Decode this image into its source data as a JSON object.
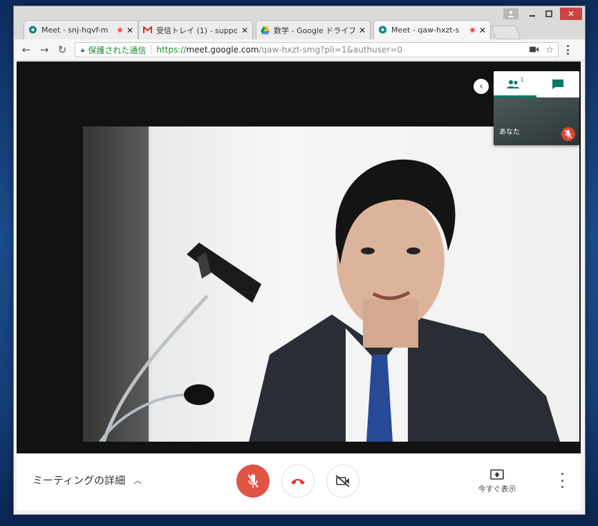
{
  "browser": {
    "tabs": [
      {
        "title": "Meet - snj-hqvf-m",
        "icon": "meet-icon",
        "recording": true,
        "active": false
      },
      {
        "title": "受信トレイ (1) - suppo",
        "icon": "gmail-icon",
        "recording": false,
        "active": false
      },
      {
        "title": "数学 - Google ドライブ",
        "icon": "drive-icon",
        "recording": false,
        "active": false
      },
      {
        "title": "Meet - qaw-hxzt-s",
        "icon": "meet-icon",
        "recording": true,
        "active": true
      }
    ],
    "address_bar": {
      "secure_label": "保護された通信",
      "scheme": "https://",
      "host": "meet.google.com",
      "path": "/qaw-hxzt-smg?pli=1&authuser=0"
    }
  },
  "meet": {
    "side_panel": {
      "people_count": "1",
      "self_label": "あなた"
    },
    "bottom_bar": {
      "meeting_details_label": "ミーティングの詳細",
      "present_now_label": "今すぐ表示"
    },
    "colors": {
      "mic_off": "#e05446",
      "hangup": "#db4437",
      "accent": "#00796b"
    }
  }
}
